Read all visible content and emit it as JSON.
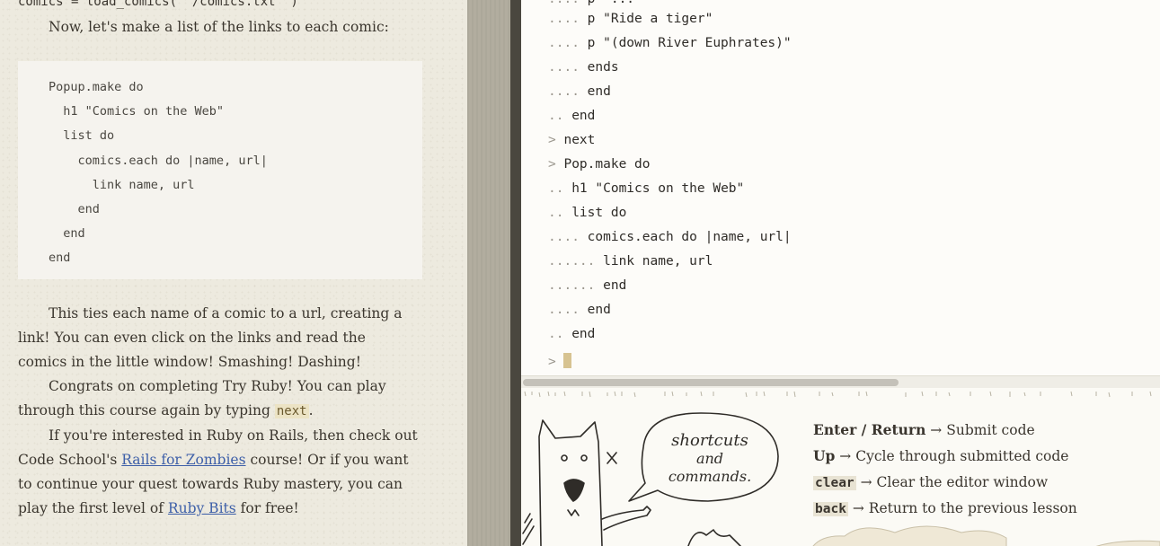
{
  "lesson": {
    "top_code": "comics = load_comics( '/comics.txt' )",
    "intro": "Now, let's make a list of the links to each comic:",
    "code_block": [
      "Popup.make do",
      "  h1 \"Comics on the Web\"",
      "  list do",
      "    comics.each do |name, url|",
      "      link name, url",
      "    end",
      "  end",
      "end"
    ],
    "para1": "This ties each name of a comic to a url, creating a link! You can even click on the links and read the comics in the little window! Smashing! Dashing!",
    "para2_before": "Congrats on completing Try Ruby! You can play through this course again by typing ",
    "para2_code": "next",
    "para2_after": ".",
    "para3_before": "If you're interested in Ruby on Rails, then check out Code School's ",
    "link_rails": "Rails for Zombies",
    "para3_middle": " course! Or if you want to continue your quest towards Ruby mastery, you can play the first level of ",
    "link_bits": "Ruby Bits",
    "para3_after": " for free!"
  },
  "console": {
    "lines": [
      {
        "prompt": "....",
        "code": " p \"Ride a tiger\""
      },
      {
        "prompt": "....",
        "code": " p \"(down River Euphrates)\""
      },
      {
        "prompt": "....",
        "code": " ends"
      },
      {
        "prompt": "....",
        "code": " end"
      },
      {
        "prompt": "..",
        "code": " end"
      },
      {
        "prompt": ">",
        "code": " next"
      },
      {
        "prompt": ">",
        "code": " Pop.make do"
      },
      {
        "prompt": "..",
        "code": " h1 \"Comics on the Web\""
      },
      {
        "prompt": "..",
        "code": " list do"
      },
      {
        "prompt": "....",
        "code": " comics.each do |name, url|"
      },
      {
        "prompt": "......",
        "code": " link name, url"
      },
      {
        "prompt": "......",
        "code": " end"
      },
      {
        "prompt": "....",
        "code": " end"
      },
      {
        "prompt": "..",
        "code": " end"
      }
    ],
    "input_prompt": ">"
  },
  "help": {
    "bubble": [
      "shortcuts",
      "and",
      "commands."
    ],
    "shortcuts": [
      {
        "key": "Enter / Return",
        "desc": "Submit code",
        "mono": false
      },
      {
        "key": "Up",
        "desc": "Cycle through submitted code",
        "mono": false
      },
      {
        "key": "clear",
        "desc": "Clear the editor window",
        "mono": true
      },
      {
        "key": "back",
        "desc": "Return to the previous lesson",
        "mono": true
      }
    ],
    "arrow": "→"
  },
  "colors": {
    "link": "#3d5fa8",
    "console_bg": "#fdfcf9",
    "cursor": "#d7c391",
    "divider": "#4a473f"
  }
}
